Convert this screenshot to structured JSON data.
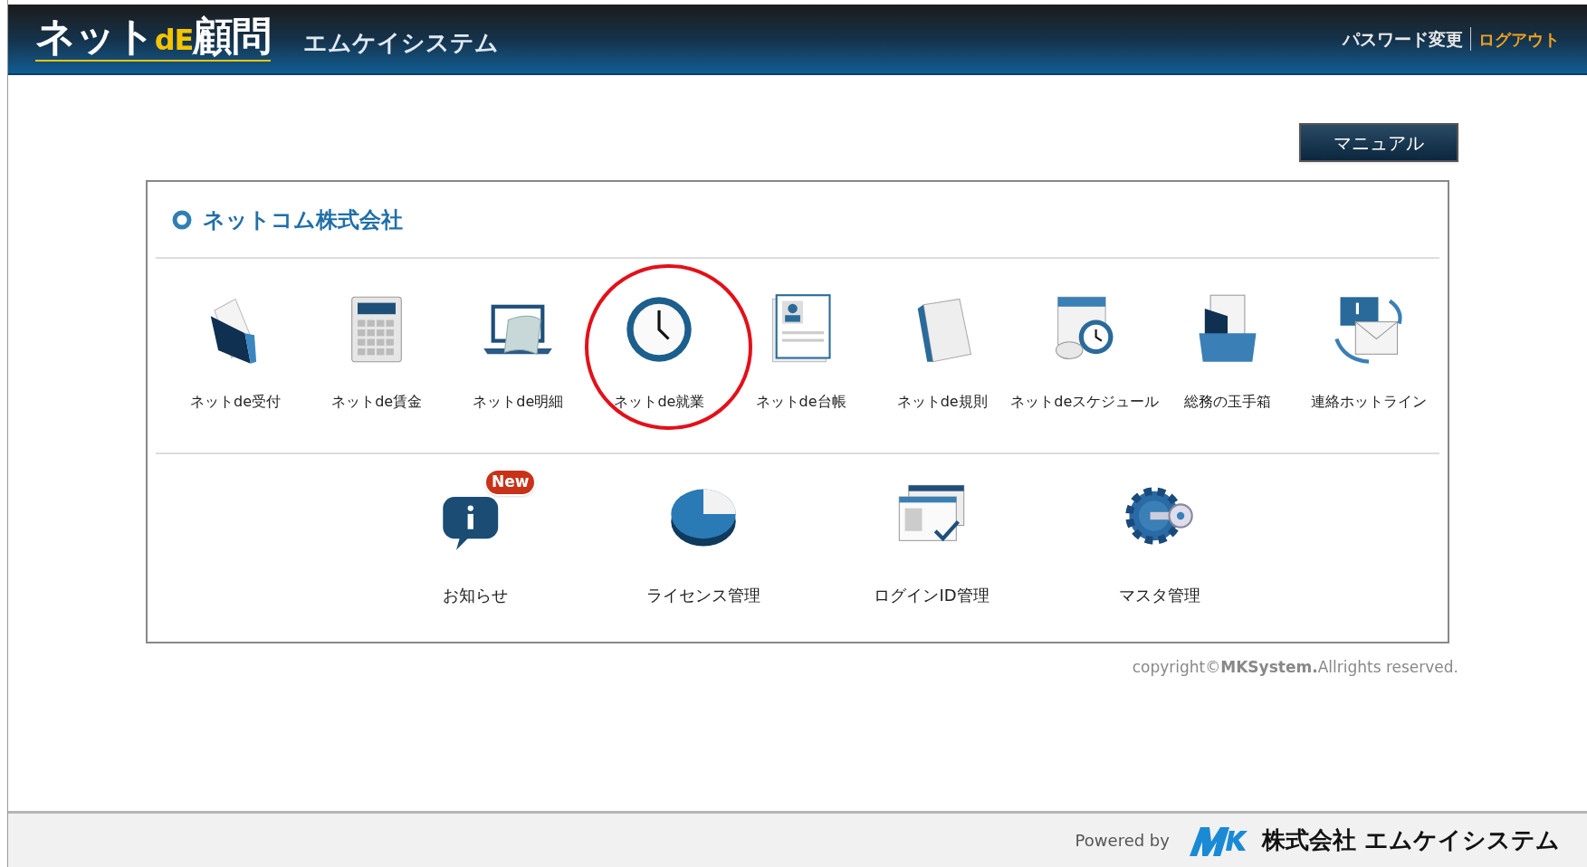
{
  "header": {
    "logo": {
      "prefix": "ネット",
      "accent": "dE",
      "suffix": "顧問"
    },
    "company": "エムケイシステム",
    "links": [
      {
        "label": "パスワード変更",
        "kind": "normal"
      },
      {
        "label": "ログアウト",
        "kind": "accent"
      }
    ]
  },
  "manual_button": "マニュアル",
  "panel": {
    "title": "ネットコム株式会社",
    "apps": [
      {
        "label": "ネットde受付",
        "highlighted": false
      },
      {
        "label": "ネットde賃金",
        "highlighted": false
      },
      {
        "label": "ネットde明細",
        "highlighted": false
      },
      {
        "label": "ネットde就業",
        "highlighted": true
      },
      {
        "label": "ネットde台帳",
        "highlighted": false
      },
      {
        "label": "ネットde規則",
        "highlighted": false
      },
      {
        "label": "ネットdeスケジュール",
        "highlighted": false
      },
      {
        "label": "総務の玉手箱",
        "highlighted": false
      },
      {
        "label": "連絡ホットライン",
        "highlighted": false
      }
    ],
    "admin": [
      {
        "label": "お知らせ",
        "badge": "New"
      },
      {
        "label": "ライセンス管理"
      },
      {
        "label": "ログインID管理"
      },
      {
        "label": "マスタ管理"
      }
    ]
  },
  "copyright": "copyright©**MKSystem.**Allrights reserved.",
  "footer": {
    "powered_by": "Powered by",
    "company": "株式会社 エムケイシステム"
  }
}
